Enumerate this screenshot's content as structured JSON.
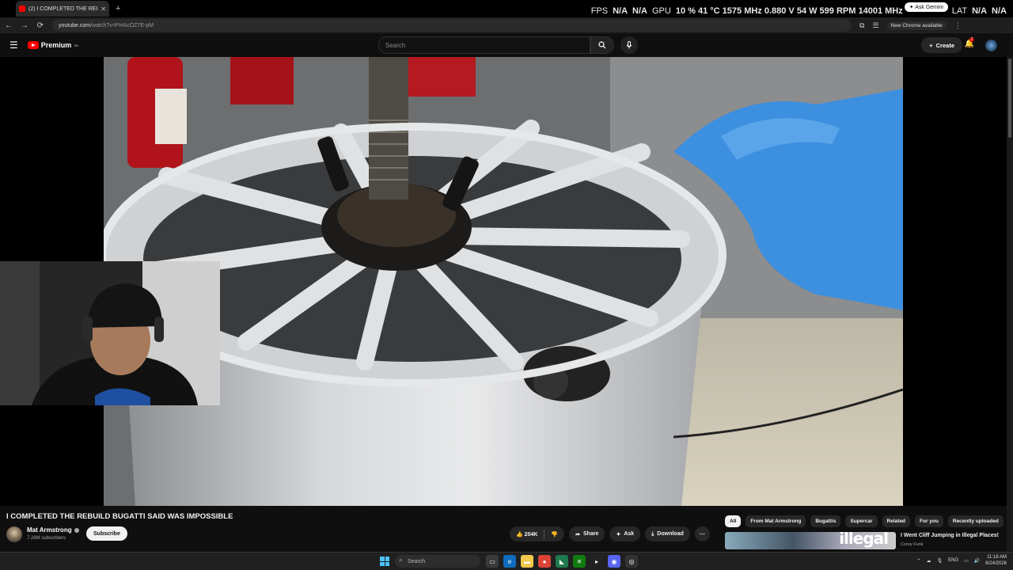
{
  "browser": {
    "tab_title": "(2) I COMPLETED THE REBUIL",
    "tab_close": "✕",
    "new_tab": "+",
    "url_host": "youtube.com",
    "url_path": "/watch?v=PHAcOZ7E-pM",
    "ask_gemini": "✦ Ask Gemini",
    "chrome_available": "New Chrome available",
    "nav_back": "←",
    "nav_forward": "→",
    "nav_reload": "⟳"
  },
  "overlay": {
    "fps_label": "FPS",
    "fps_val1": "N/A",
    "fps_val2": "N/A",
    "gpu_label": "GPU",
    "gpu_stats": "10 % 41 °C 1575 MHz 0.880 V 54 W 599 RPM 14001 MHz",
    "lat_label": "LAT",
    "lat_val1": "N/A",
    "lat_val2": "N/A"
  },
  "youtube": {
    "logo_text": "Premium",
    "logo_sup": "TH",
    "search_placeholder": "Search",
    "create_label": "Create",
    "notif_count": "2"
  },
  "video": {
    "title": "I COMPLETED THE REBUILD BUGATTI SAID WAS IMPOSSIBLE",
    "channel": "Mat Armstrong",
    "subscribers": "7.26M subscribers",
    "subscribe_label": "Subscribe",
    "likes": "204K",
    "share_label": "Share",
    "ask_label": "Ask",
    "download_label": "Download"
  },
  "chips": [
    "All",
    "From Mat Armstrong",
    "Bugattis",
    "Supercar",
    "Related",
    "For you",
    "Recently uploaded"
  ],
  "recommended": {
    "title": "I Went Cliff Jumping in Illegal Places!",
    "channel": "Corey Funk",
    "thumb_text": "illegal"
  },
  "taskbar": {
    "search_placeholder": "Search",
    "lang": "ENG",
    "time": "11:18 AM",
    "date": "6/24/2026"
  },
  "colors": {
    "yt_red": "#ff0000",
    "background": "#0f0f0f",
    "glove_blue": "#3d8fe0"
  }
}
